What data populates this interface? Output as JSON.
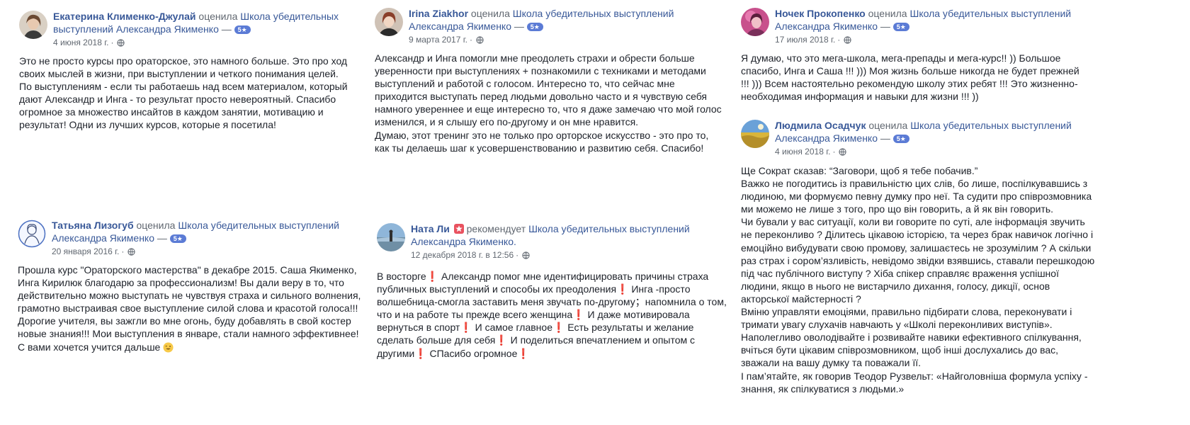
{
  "reviews": [
    {
      "name": "Екатерина Клименко-Джулай",
      "verb": "оценила",
      "page": "Школа убедительных выступлений Александра Якименко",
      "dash": "—",
      "rating": "5★",
      "date": "4 июня 2018 г.",
      "sep": "·",
      "text": "Это не просто курсы про ораторское, это намного больше. Это про ход своих мыслей в жизни, при выступлении и четкого понимания целей.\nПо выступлениям - если ты работаешь над всем материалом, который дают Александр и Инга - то результат просто невероятный. Спасибо огромное за множество инсайтов в каждом занятии, мотивацию и результат! Одни из лучших курсов, которые я посетила!",
      "avatar_icon": "woman-portrait-avatar"
    },
    {
      "name": "Irina Ziakhor",
      "verb": "оценила",
      "page": "Школа убедительных выступлений Александра Якименко",
      "dash": "—",
      "rating": "5★",
      "date": "9 марта 2017 г.",
      "sep": "·",
      "text": "Александр и Инга помогли мне преодолеть страхи и обрести больше уверенности при выступлениях + познакомили с техниками и методами выступлений и работой с голосом. Интересно то, что сейчас мне приходится выступать перед людьми довольно часто и я чувствую себя намного увереннее и еще интересно то, что я даже замечаю что мой голос изменился, и я слышу его по-другому и он мне нравится.\nДумаю, этот тренинг это не только про орторское искусство - это про то, как ты делаешь шаг к усовершенствованию и развитию себя. Спасибо!",
      "avatar_icon": "woman-portrait-avatar"
    },
    {
      "name": "Ночек Прокопенко",
      "verb": "оценила",
      "page": "Школа убедительных выступлений Александра Якименко",
      "dash": "—",
      "rating": "5★",
      "date": "17 июля 2018 г.",
      "sep": "·",
      "text": "Я думаю, что это мега-школа, мега-препады и мега-курс!! )) Большое спасибо, Инга и Саша !!! ))) Моя жизнь больше никогда не будет прежней !!! ))) Всем настоятельно рекомендую школу этих ребят !!! Это жизненно-необходимая информация и навыки для жизни !!! ))",
      "avatar_icon": "woman-portrait-avatar"
    },
    {
      "name": "Людмила Осадчук",
      "verb": "оценила",
      "page": "Школа убедительных выступлений Александра Якименко",
      "dash": "—",
      "rating": "5★",
      "date": "4 июня 2018 г.",
      "sep": "·",
      "text": "Ще Сократ сказав: “Заговори, щоб я тебе побачив.”\nВажко не погодитись із правильністю цих слів, бо лише, поспілкувавшись з людиною, ми формуємо певну думку про неї. Та судити про співрозмовника ми можемо не лише з того, про що він говорить, а й як він говорить.\nЧи бували у вас ситуації, коли ви говорите по суті, але інформація звучить не переконливо ? Ділитесь цікавою історією, та через брак навичок логічно і емоційно вибудувати свою промову, залишаєтесь не зрозумілим ? А скільки раз страх і сором’язливість, невідомо звідки взявшись, ставали перешкодою під час публічного виступу ? Хіба спікер справляє враження успішної людини, якщо в нього не вистарчило дихання, голосу, дикції, основ акторської майстерності ?\nВміню управляти емоціями, правильно підбирати слова, переконувати і тримати увагу слухачів навчають у «Школі переконливих виступів».\nНаполегливо оволодівайте і розвивайте навики ефективного спілкування, вчіться бути цікавим співрозмовником, щоб інші дослухались до вас, зважали на вашу думку та поважали її.\nІ пам’ятайте, як говорив Теодор Рузвельт: «Найголовніша формула успіху - знання, як спілкуватися з людьми.»",
      "avatar_icon": "landscape-avatar"
    },
    {
      "name": "Татьяна Лизогуб",
      "verb": "оценила",
      "page": "Школа убедительных выступлений Александра Якименко",
      "dash": "—",
      "rating": "5★",
      "date": "20 января 2016 г.",
      "sep": "·",
      "text": "Прошла курс \"Ораторского мастерства\" в декабре 2015. Саша Якименко, Инга Кирилюк благодарю за профессионализм! Вы дали веру в то, что действительно можно выступать не чувствуя страха и сильного волнения, грамотно выстраивая свое выступление силой слова и красотой голоса!!! Дорогие учителя, вы зажгли во мне огонь, буду добавлять в свой костер новые знания!!! Мои выступления в январе, стали намного эффективнее! С вами хочется учится дальше",
      "avatar_icon": "woman-drawing-avatar"
    },
    {
      "name": "Ната Ли",
      "verb": "рекомендует",
      "page": "Школа убедительных выступлений Александра Якименко.",
      "date": "12 декабря 2018 г. в 12:56",
      "sep": "·",
      "text": "В восторге❗ Александр помог мне идентифицировать причины страха публичных выступлений и способы их преодоления❗ Инга -просто волшебница-смогла заставить меня звучать по-другому；напомнила о том, что и на работе ты прежде всего женщина❗ И даже мотивировала вернуться в спорт❗ И самое главное❗ Есть результаты и желание сделать больше для себя❗ И поделиться впечатлением и опытом с другими❗ СПасибо огромное❗",
      "avatar_icon": "beach-photo-avatar"
    }
  ],
  "colors": {
    "link": "#385898",
    "muted": "#606770",
    "text": "#1d2129",
    "badge": "#5b7bd5",
    "recommend_badge": "#e9525f"
  }
}
